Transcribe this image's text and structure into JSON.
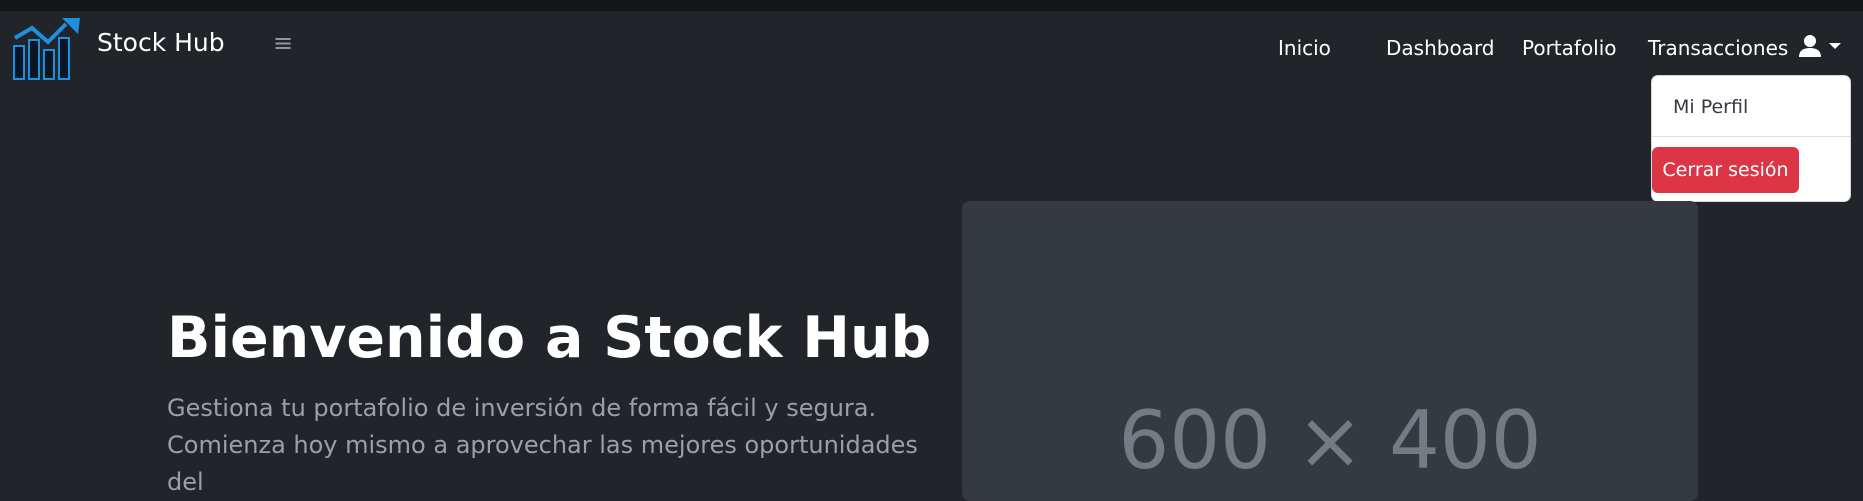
{
  "brand": {
    "name": "Stock Hub",
    "logo_icon": "stock-chart-logo-icon"
  },
  "nav": {
    "menu_icon": "≡",
    "links": [
      "Inicio",
      "Dashboard",
      "Portafolio",
      "Transacciones"
    ],
    "user_icon": "user-icon"
  },
  "user_menu": {
    "profile": "Mi Perfil",
    "logout": "Cerrar sesión"
  },
  "hero": {
    "title": "Bienvenido a Stock Hub",
    "text": "Gestiona tu portafolio de inversión de forma fácil y segura. Comienza hoy mismo a aprovechar las mejores oportunidades del"
  },
  "placeholder": {
    "label": "600 × 400"
  },
  "colors": {
    "background": "#212529",
    "danger": "#dc3545",
    "placeholder": "#343a40",
    "logo_blue": "#1f8fe0"
  }
}
